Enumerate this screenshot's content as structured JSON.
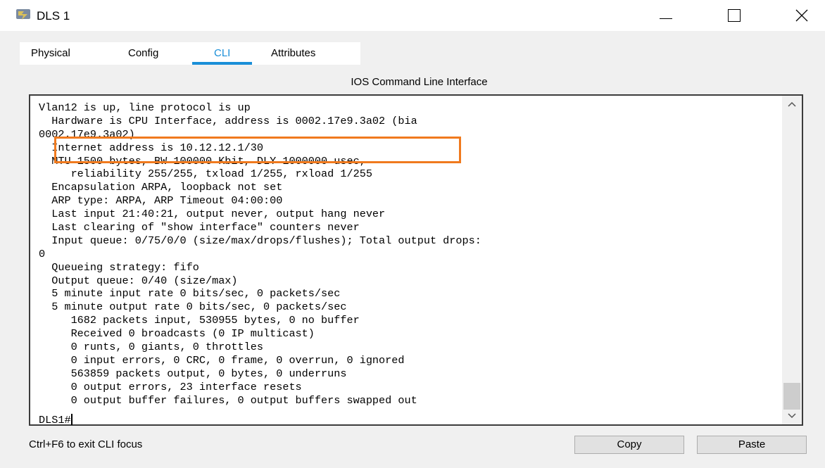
{
  "window": {
    "title": "DLS 1"
  },
  "tabs": [
    {
      "label": "Physical",
      "active": false
    },
    {
      "label": "Config",
      "active": false
    },
    {
      "label": "CLI",
      "active": true
    },
    {
      "label": "Attributes",
      "active": false
    }
  ],
  "panel": {
    "title": "IOS Command Line Interface"
  },
  "terminal": {
    "lines": [
      "Vlan12 is up, line protocol is up",
      "  Hardware is CPU Interface, address is 0002.17e9.3a02 (bia",
      "0002.17e9.3a02)",
      "  Internet address is 10.12.12.1/30",
      "  MTU 1500 bytes, BW 100000 Kbit, DLY 1000000 usec,",
      "     reliability 255/255, txload 1/255, rxload 1/255",
      "  Encapsulation ARPA, loopback not set",
      "  ARP type: ARPA, ARP Timeout 04:00:00",
      "  Last input 21:40:21, output never, output hang never",
      "  Last clearing of \"show interface\" counters never",
      "  Input queue: 0/75/0/0 (size/max/drops/flushes); Total output drops:",
      "0",
      "  Queueing strategy: fifo",
      "  Output queue: 0/40 (size/max)",
      "  5 minute input rate 0 bits/sec, 0 packets/sec",
      "  5 minute output rate 0 bits/sec, 0 packets/sec",
      "     1682 packets input, 530955 bytes, 0 no buffer",
      "     Received 0 broadcasts (0 IP multicast)",
      "     0 runts, 0 giants, 0 throttles",
      "     0 input errors, 0 CRC, 0 frame, 0 overrun, 0 ignored",
      "     563859 packets output, 0 bytes, 0 underruns",
      "     0 output errors, 23 interface resets",
      "     0 output buffer failures, 0 output buffers swapped out"
    ],
    "prompt": "DLS1#"
  },
  "footer": {
    "hint": "Ctrl+F6 to exit CLI focus",
    "copy_label": "Copy",
    "paste_label": "Paste"
  },
  "colors": {
    "accent": "#1a8fd8",
    "highlight": "#f07a1e"
  }
}
